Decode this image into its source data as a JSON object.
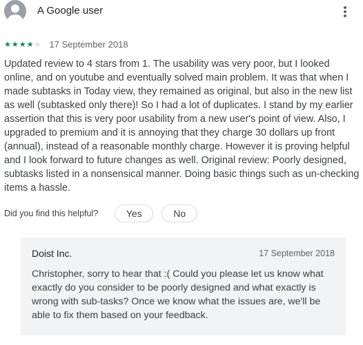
{
  "review": {
    "user_name": "A Google user",
    "avatar_icon": "person-icon",
    "menu_icon": "more-vert-icon",
    "rating": 4,
    "rating_max": 5,
    "star_color": "#01875f",
    "date": "17 September 2018",
    "text": "Updated review to 4 stars from 1. The usability was very poor, but I looked online, and on youtube and eventually solved main problem. It was that when I made subtasks in Today view, they remained as original, but also in the new list as well (subtasked only there)! So I had a lot of duplicates. I stand by my earlier assertion that this is very poor usability from a new user's point of view. Also, I upgraded to premium and it is annoying that they charge 30 dollars up front (annual), instead of a reasonable monthly charge. However it is proving helpful and I look forward to future changes as well. Original review: Poorly designed, subtasks listed in a nonsensical manner. Doing basic things such as un-checking items a hassle."
  },
  "helpful": {
    "label": "Did you find this helpful?",
    "yes_label": "Yes",
    "no_label": "No"
  },
  "reply": {
    "developer_name": "Doist Inc.",
    "date": "17 September 2018",
    "text": "Christopher, sorry to hear that :( Could you please let us know what exactly do you consider to be poorly designed and what exactly is wrong with sub-tasks? Once we know what the issues are, we'll be able to fix them based on your feedback.",
    "background_color": "#f1f3f4"
  }
}
